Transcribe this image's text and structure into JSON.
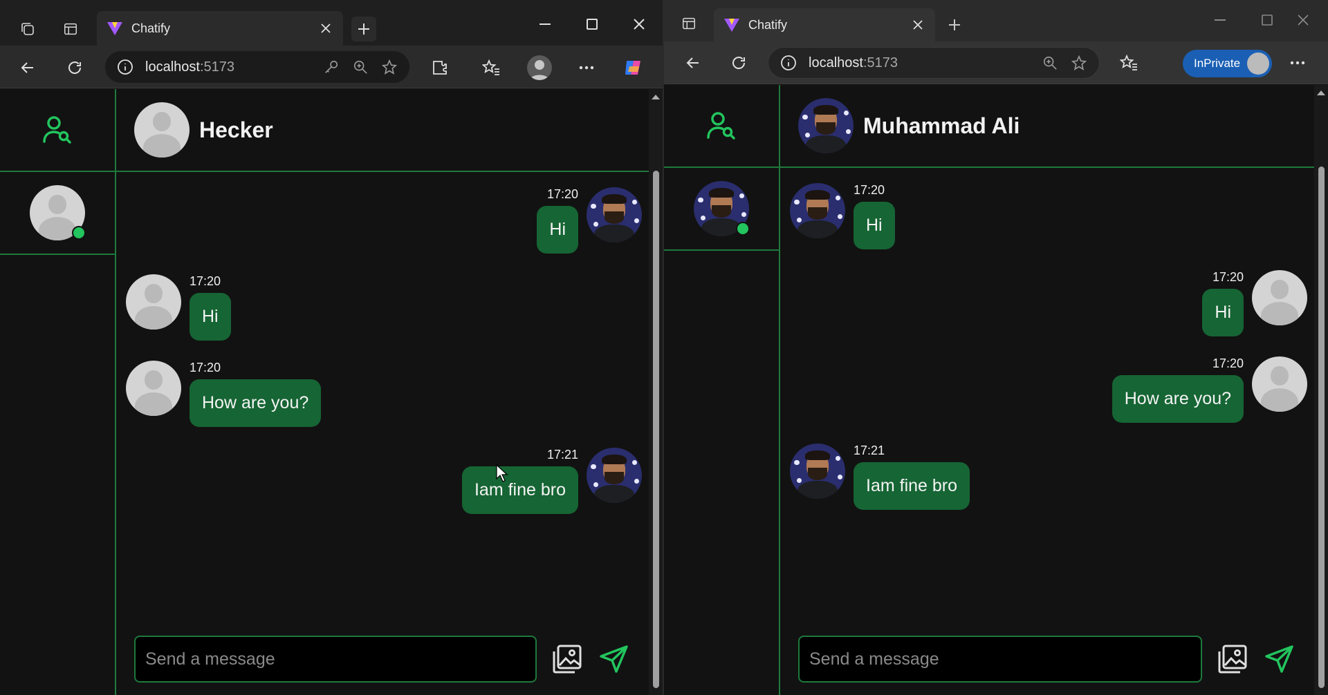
{
  "left_window": {
    "tab_title": "Chatify",
    "url_host": "localhost",
    "url_port": ":5173",
    "chat_header_name": "Hecker",
    "input_placeholder": "Send a message",
    "messages": [
      {
        "side": "right",
        "time": "17:20",
        "text": "Hi",
        "avatar": "photo"
      },
      {
        "side": "left",
        "time": "17:20",
        "text": "Hi",
        "avatar": "default"
      },
      {
        "side": "left",
        "time": "17:20",
        "text": "How are you?",
        "avatar": "default"
      },
      {
        "side": "right",
        "time": "17:21",
        "text": "Iam fine bro",
        "avatar": "photo"
      }
    ]
  },
  "right_window": {
    "tab_title": "Chatify",
    "url_host": "localhost",
    "url_port": ":5173",
    "inprivate_label": "InPrivate",
    "chat_header_name": "Muhammad Ali",
    "input_placeholder": "Send a message",
    "messages": [
      {
        "side": "left",
        "time": "17:20",
        "text": "Hi",
        "avatar": "photo"
      },
      {
        "side": "right",
        "time": "17:20",
        "text": "Hi",
        "avatar": "default"
      },
      {
        "side": "right",
        "time": "17:20",
        "text": "How are you?",
        "avatar": "default"
      },
      {
        "side": "left",
        "time": "17:21",
        "text": "Iam fine bro",
        "avatar": "photo"
      }
    ]
  },
  "colors": {
    "accent_green": "#166534",
    "border_green": "#1e7a3c",
    "online_dot": "#22c55e",
    "inprivate_blue": "#1a5fb4"
  },
  "icons": [
    "workspaces-icon",
    "tab-actions-icon",
    "chatify-logo-icon",
    "close-tab-icon",
    "new-tab-icon",
    "minimize-icon",
    "maximize-icon",
    "close-window-icon",
    "back-icon",
    "refresh-icon",
    "site-info-icon",
    "password-key-icon",
    "zoom-icon",
    "favorite-star-icon",
    "extensions-icon",
    "favorites-icon",
    "profile-icon",
    "more-icon",
    "copilot-icon",
    "find-user-icon",
    "image-upload-icon",
    "send-icon"
  ]
}
